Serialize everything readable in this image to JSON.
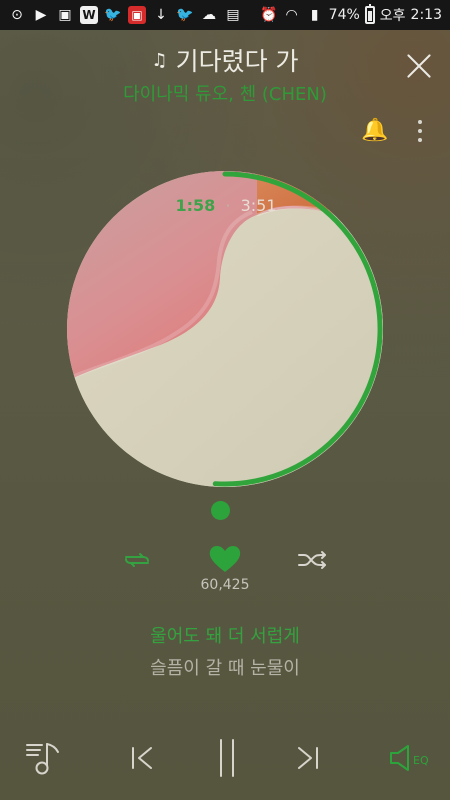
{
  "status_bar": {
    "left_icons": [
      "music-circle-icon",
      "youtube-icon",
      "image-icon",
      "w-app-icon",
      "twitter-icon",
      "red-app-icon",
      "download-icon",
      "twitter-icon",
      "weather-icon",
      "file-icon"
    ],
    "battery_percent": "74%",
    "ampm": "오후",
    "time": "2:13"
  },
  "player": {
    "song_title": "기다렸다 가",
    "artist": "다이나믹 듀오, 첸 (CHEN)",
    "elapsed": "1:58",
    "total": "3:51",
    "likes": "60,425",
    "current_lyric": "울어도 돼 더 서럽게",
    "next_lyric": "슬픔이 갈 때 눈물이",
    "progress_fraction": 0.51
  },
  "colors": {
    "accent_green": "#2ca33b",
    "background": "#5a5a45",
    "status_bar": "#161616"
  }
}
